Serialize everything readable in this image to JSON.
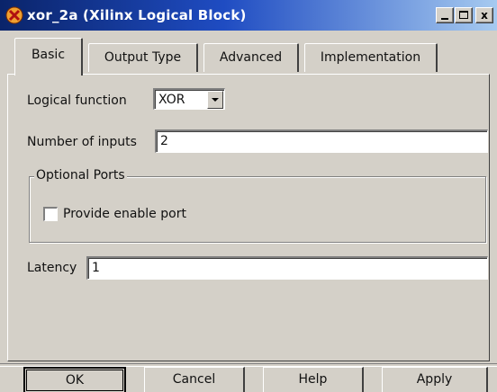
{
  "window": {
    "title": "xor_2a (Xilinx Logical Block)",
    "controls": {
      "minimize": "_",
      "maximize": "□",
      "close": "x"
    }
  },
  "tabs": [
    {
      "label": "Basic",
      "active": true
    },
    {
      "label": "Output Type",
      "active": false
    },
    {
      "label": "Advanced",
      "active": false
    },
    {
      "label": "Implementation",
      "active": false
    }
  ],
  "form": {
    "logical_function": {
      "label": "Logical function",
      "value": "XOR"
    },
    "number_of_inputs": {
      "label": "Number of inputs",
      "value": "2"
    },
    "optional_ports": {
      "legend": "Optional Ports",
      "provide_enable": {
        "label": "Provide enable port",
        "checked": false
      }
    },
    "latency": {
      "label": "Latency",
      "value": "1"
    }
  },
  "buttons": {
    "ok": "OK",
    "cancel": "Cancel",
    "help": "Help",
    "apply": "Apply"
  },
  "colors": {
    "title_start": "#0a246a",
    "title_end": "#a6caf0",
    "face": "#d4d0c8"
  }
}
